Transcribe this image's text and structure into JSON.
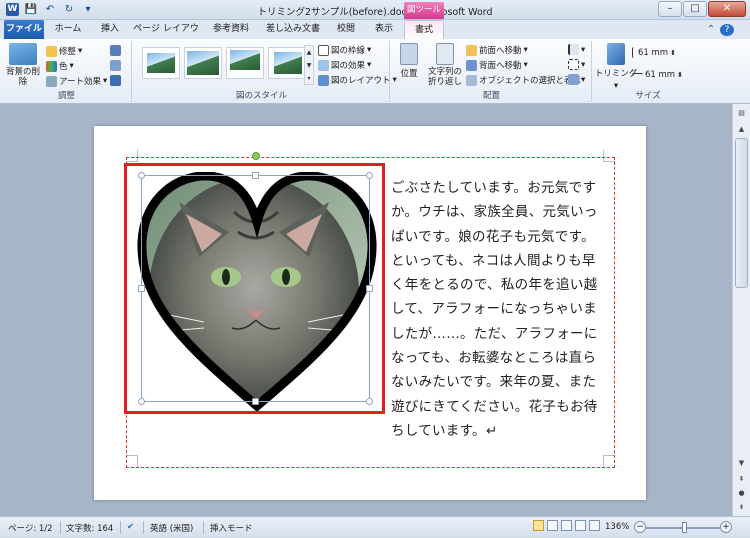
{
  "app": {
    "title": "トリミング2サンプル(before).docx - Microsoft Word",
    "word_icon": "W",
    "context_header": "図ツール"
  },
  "tabs": [
    "ファイル",
    "ホーム",
    "挿入",
    "ページ レイアウト",
    "参考資料",
    "差し込み文書",
    "校閲",
    "表示",
    "書式"
  ],
  "ribbon": {
    "adjust": {
      "remove_bg": "背景の削除",
      "corrections": "修整",
      "color": "色",
      "art_effects": "アート効果",
      "label": "調整"
    },
    "styles": {
      "border": "図の枠線",
      "effects": "図の効果",
      "layout": "図のレイアウト",
      "label": "図のスタイル"
    },
    "arrange": {
      "position": "位置",
      "wrap_text": "文字列の折り返し",
      "bring_forward": "前面へ移動",
      "send_backward": "背面へ移動",
      "selection_pane": "オブジェクトの選択と表示",
      "label": "配置"
    },
    "size": {
      "crop": "トリミング",
      "height": "61 mm",
      "width": "61 mm",
      "label": "サイズ"
    }
  },
  "document": {
    "lines": [
      "ごぶさたしています。お元気です",
      "か。ウチは、家族全員、元気いっ",
      "ぱいです。娘の花子も元気です。",
      "といっても、ネコは人間よりも早",
      "く年をとるので、私の年を追い越",
      "して、アラフォーになっちゃいま",
      "したが……。ただ、アラフォーに",
      "なっても、お転婆なところは直ら",
      "ないみたいです。来年の夏、また",
      "遊びにきてください。花子もお待",
      "ちしています。↵"
    ]
  },
  "status": {
    "page": "ページ: 1/2",
    "words": "文字数: 164",
    "language": "英語 (米国)",
    "mode": "挿入モード",
    "zoom": "136%"
  },
  "colors": {
    "context_accent": "#d6388d",
    "selection_red": "#e02020",
    "file_tab": "#2a63b8"
  }
}
